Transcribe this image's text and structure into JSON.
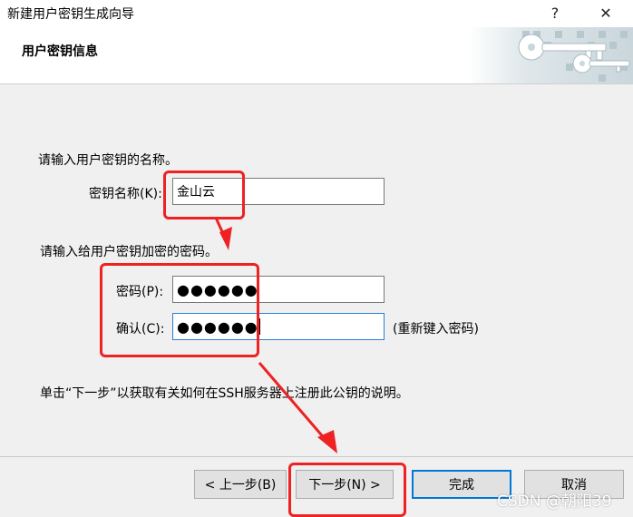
{
  "window": {
    "title": "新建用户密钥生成向导",
    "help_label": "?",
    "close_label": "✕"
  },
  "header": {
    "title": "用户密钥信息",
    "art_icon": "key-icon"
  },
  "form": {
    "name_prompt": "请输入用户密钥的名称。",
    "name_label": "密钥名称(K):",
    "name_value": "金山云",
    "pass_prompt": "请输入给用户密钥加密的密码。",
    "password_label": "密码(P):",
    "password_value": "●●●●●●",
    "confirm_label": "确认(C):",
    "confirm_value": "●●●●●●",
    "confirm_hint": "(重新键入密码)",
    "instruction": "单击“下一步”以获取有关如何在SSH服务器上注册此公钥的说明。"
  },
  "buttons": {
    "back": "< 上一步(B)",
    "next": "下一步(N) >",
    "finish": "完成",
    "cancel": "取消"
  },
  "watermark": "CSDN @朝阳39",
  "colors": {
    "annotation": "#ee2222",
    "focus": "#0078d7"
  }
}
